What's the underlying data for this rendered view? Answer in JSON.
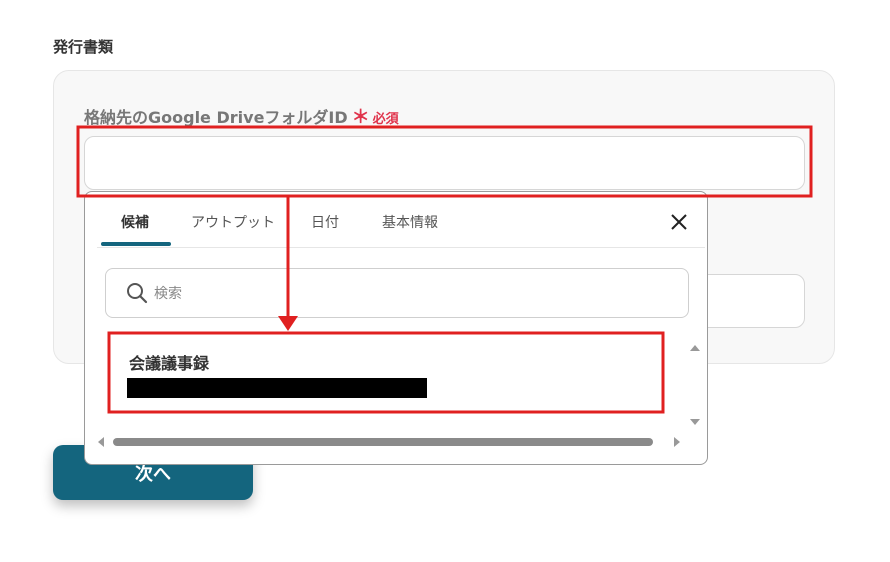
{
  "section": {
    "title": "発行書類"
  },
  "field": {
    "label": "格納先のGoogle DriveフォルダID",
    "required_mark": "＊",
    "required_text": "必須",
    "value": ""
  },
  "next_button": {
    "label": "次へ"
  },
  "popup": {
    "tabs": [
      {
        "label": "候補",
        "active": true
      },
      {
        "label": "アウトプット",
        "active": false
      },
      {
        "label": "日付",
        "active": false
      },
      {
        "label": "基本情報",
        "active": false
      }
    ],
    "search": {
      "placeholder": "検索",
      "value": ""
    },
    "items": [
      {
        "title": "会議議事録"
      }
    ]
  },
  "colors": {
    "accent": "#14657e",
    "required": "#e0334b",
    "highlight_box": "#e02020"
  }
}
